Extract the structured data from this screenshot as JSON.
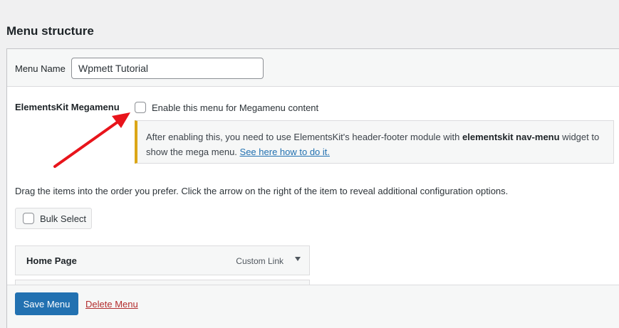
{
  "page_title": "Menu structure",
  "menu_name": {
    "label": "Menu Name",
    "value": "Wpmett Tutorial"
  },
  "megamenu": {
    "label": "ElementsKit Megamenu",
    "checkbox_label": "Enable this menu for Megamenu content",
    "checked": false,
    "notice_text_1": "After enabling this, you need to use ElementsKit's header-footer module with ",
    "notice_bold": "elementskit nav-menu",
    "notice_text_2": " widget to show the mega menu. ",
    "notice_link": "See here how to do it."
  },
  "drag_help": "Drag the items into the order you prefer. Click the arrow on the right of the item to reveal additional configuration options.",
  "bulk_select": {
    "label": "Bulk Select"
  },
  "menu_items": [
    {
      "title": "Home Page",
      "type": "Custom Link"
    }
  ],
  "footer": {
    "save_label": "Save Menu",
    "delete_label": "Delete Menu"
  },
  "colors": {
    "primary": "#2271b1",
    "danger": "#b32d2e",
    "notice_border": "#dba617",
    "annotation_arrow": "#e8141b"
  }
}
